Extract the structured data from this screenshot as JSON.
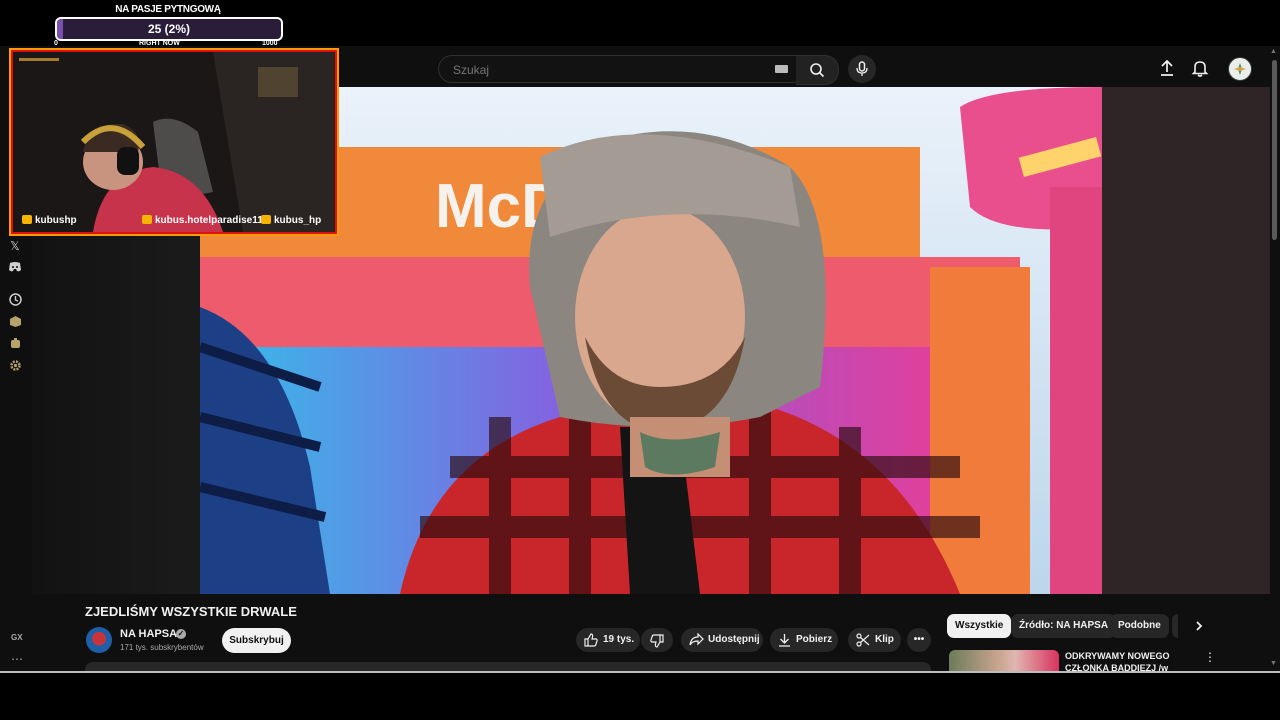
{
  "goal": {
    "title": "NA PASJE PYTNGOWĄ",
    "value_text": "25 (2%)",
    "progress_fraction": 0.025,
    "min_label": "0",
    "mid_label": "RIGHT NOW",
    "max_label": "1000"
  },
  "webcam": {
    "socials": [
      {
        "label": "kubushp",
        "icon": "twitter-icon",
        "color": "#f5b400"
      },
      {
        "label": "kubus.hotelparadise11",
        "icon": "instagram-icon",
        "color": "#f5b400"
      },
      {
        "label": "kubus_hp",
        "icon": "youtube-icon",
        "color": "#f5b400"
      }
    ],
    "border_color": "#dd1111",
    "glow_color": "#ff9c00"
  },
  "masthead": {
    "search_placeholder": "Szukaj"
  },
  "video": {
    "title": "ZJEDLIŚMY WSZYSTKIE DRWALE",
    "sign_text": "McDonald's"
  },
  "channel": {
    "name": "NA HAPSA",
    "subscribers": "171 tys. subskrybentów",
    "subscribe_label": "Subskrybuj"
  },
  "actions": {
    "likes": "19 tys.",
    "share": "Udostępnij",
    "download": "Pobierz",
    "clip": "Klip"
  },
  "chips": [
    "Wszystkie",
    "Źródło: NA HAPSA",
    "Podobne"
  ],
  "recommendation": {
    "title_line1": "ODKRYWAMY NOWEGO",
    "title_line2": "CZŁONKA BADDIEZJ /w"
  },
  "browser_sidebar": {
    "gx_label": "GX"
  }
}
